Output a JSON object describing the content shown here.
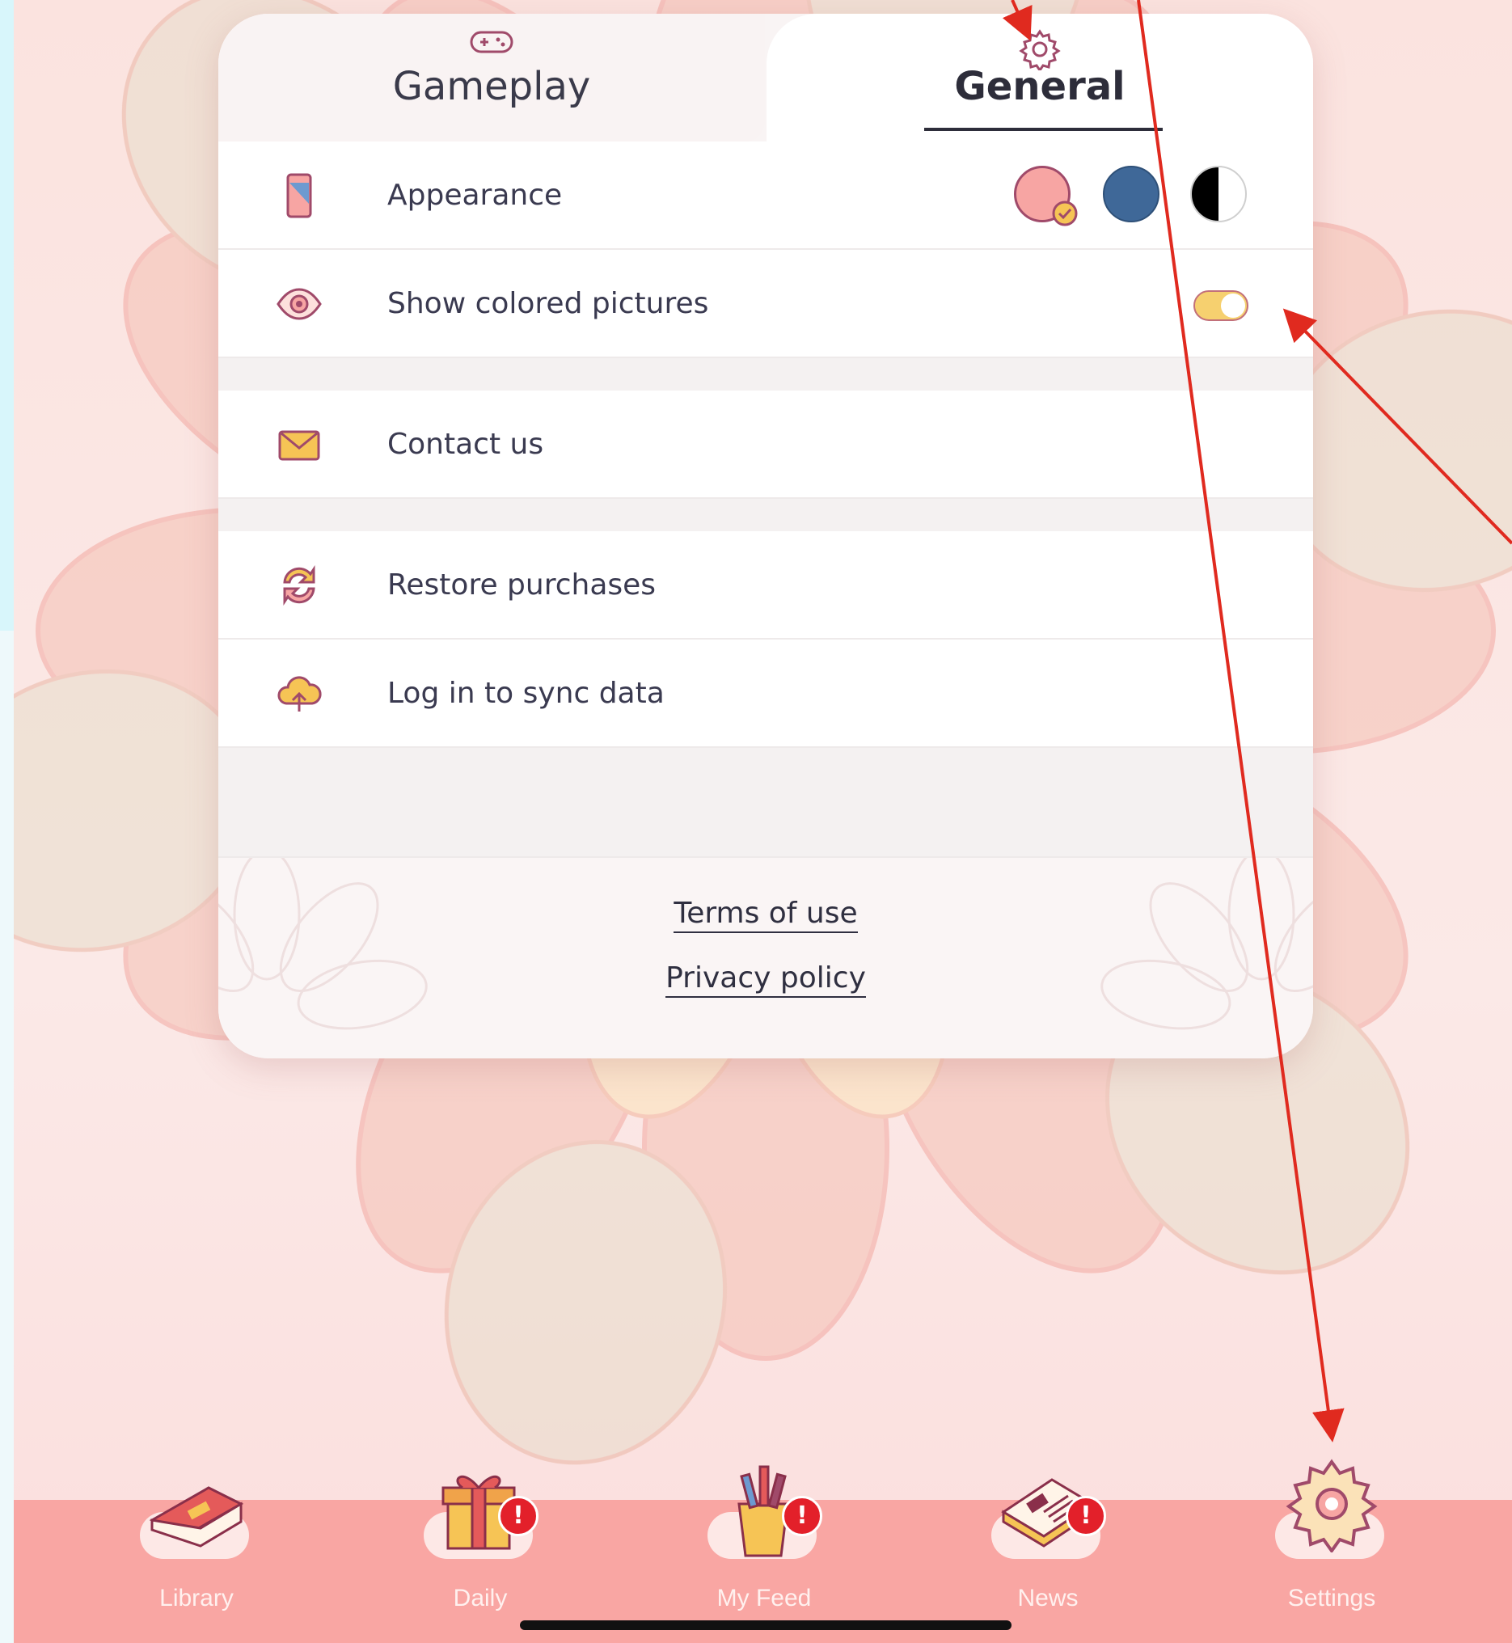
{
  "tabs": {
    "gameplay_label": "Gameplay",
    "general_label": "General",
    "active": "General"
  },
  "rows": {
    "appearance": {
      "label": "Appearance",
      "swatches": [
        "#f7a5a3",
        "#3f6898",
        "black-white"
      ],
      "selected_swatch": 0
    },
    "show_colored": {
      "label": "Show colored pictures",
      "toggle_on": true
    },
    "contact": {
      "label": "Contact us"
    },
    "restore": {
      "label": "Restore purchases"
    },
    "login": {
      "label": "Log in to sync data"
    }
  },
  "footer": {
    "terms": "Terms of use",
    "privacy": "Privacy policy"
  },
  "tabbar": [
    {
      "label": "Library",
      "icon": "book-icon",
      "badge": ""
    },
    {
      "label": "Daily",
      "icon": "gift-icon",
      "badge": "!"
    },
    {
      "label": "My Feed",
      "icon": "paint-cup-icon",
      "badge": "!"
    },
    {
      "label": "News",
      "icon": "newspaper-icon",
      "badge": "!"
    },
    {
      "label": "Settings",
      "icon": "gear-icon",
      "badge": ""
    }
  ],
  "colors": {
    "accent": "#f9a6a3",
    "annotation": "#e02a1f",
    "icon_primary": "#a04a6a"
  }
}
